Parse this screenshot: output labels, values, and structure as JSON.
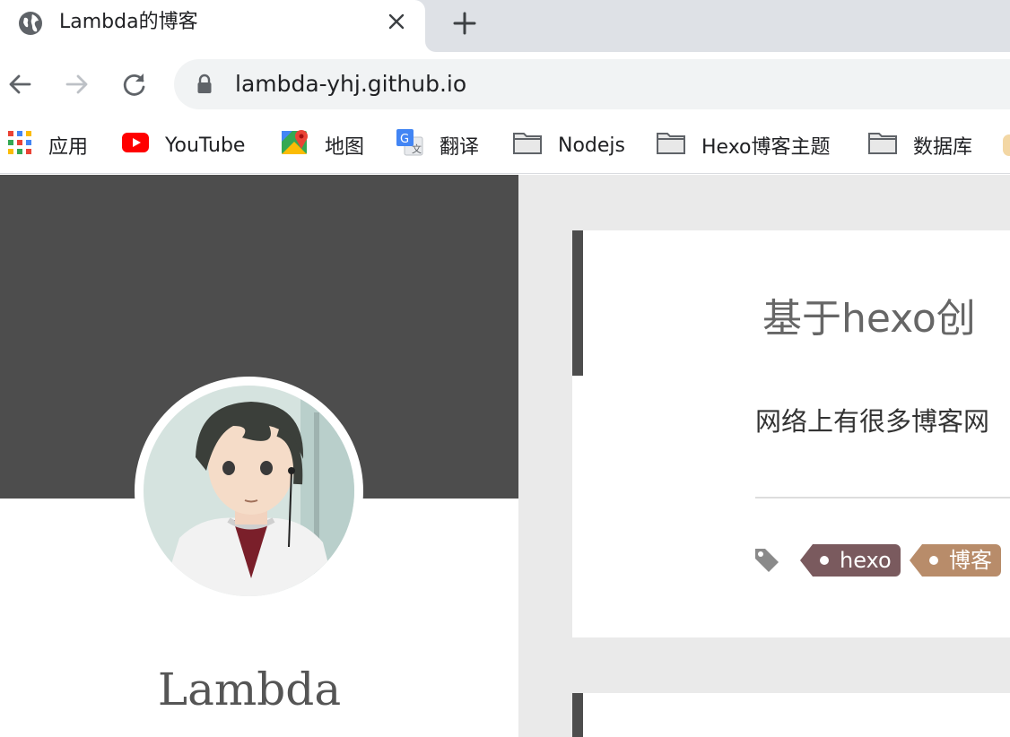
{
  "browser": {
    "tab": {
      "title": "Lambda的博客",
      "icon": "globe-icon"
    },
    "new_tab_icon": "plus-icon",
    "toolbar": {
      "url": "lambda-yhj.github.io",
      "back_icon": "arrow-left-icon",
      "forward_icon": "arrow-right-icon",
      "reload_icon": "reload-icon",
      "lock_icon": "lock-icon"
    },
    "bookmarks": [
      {
        "label": "应用",
        "icon": "apps-grid-icon"
      },
      {
        "label": "YouTube",
        "icon": "youtube-icon"
      },
      {
        "label": "地图",
        "icon": "maps-icon"
      },
      {
        "label": "翻译",
        "icon": "translate-icon"
      },
      {
        "label": "Nodejs",
        "icon": "folder-icon"
      },
      {
        "label": "Hexo博客主题",
        "icon": "folder-icon"
      },
      {
        "label": "数据库",
        "icon": "folder-icon"
      }
    ]
  },
  "page": {
    "sidebar": {
      "site_name": "Lambda",
      "banner_color": "#4d4d4d"
    },
    "post": {
      "title": "基于hexo创",
      "excerpt": "网络上有很多博客网",
      "tags": [
        {
          "label": "hexo",
          "color": "#7a5a5e"
        },
        {
          "label": "博客",
          "color": "#b88c6a"
        }
      ]
    }
  }
}
